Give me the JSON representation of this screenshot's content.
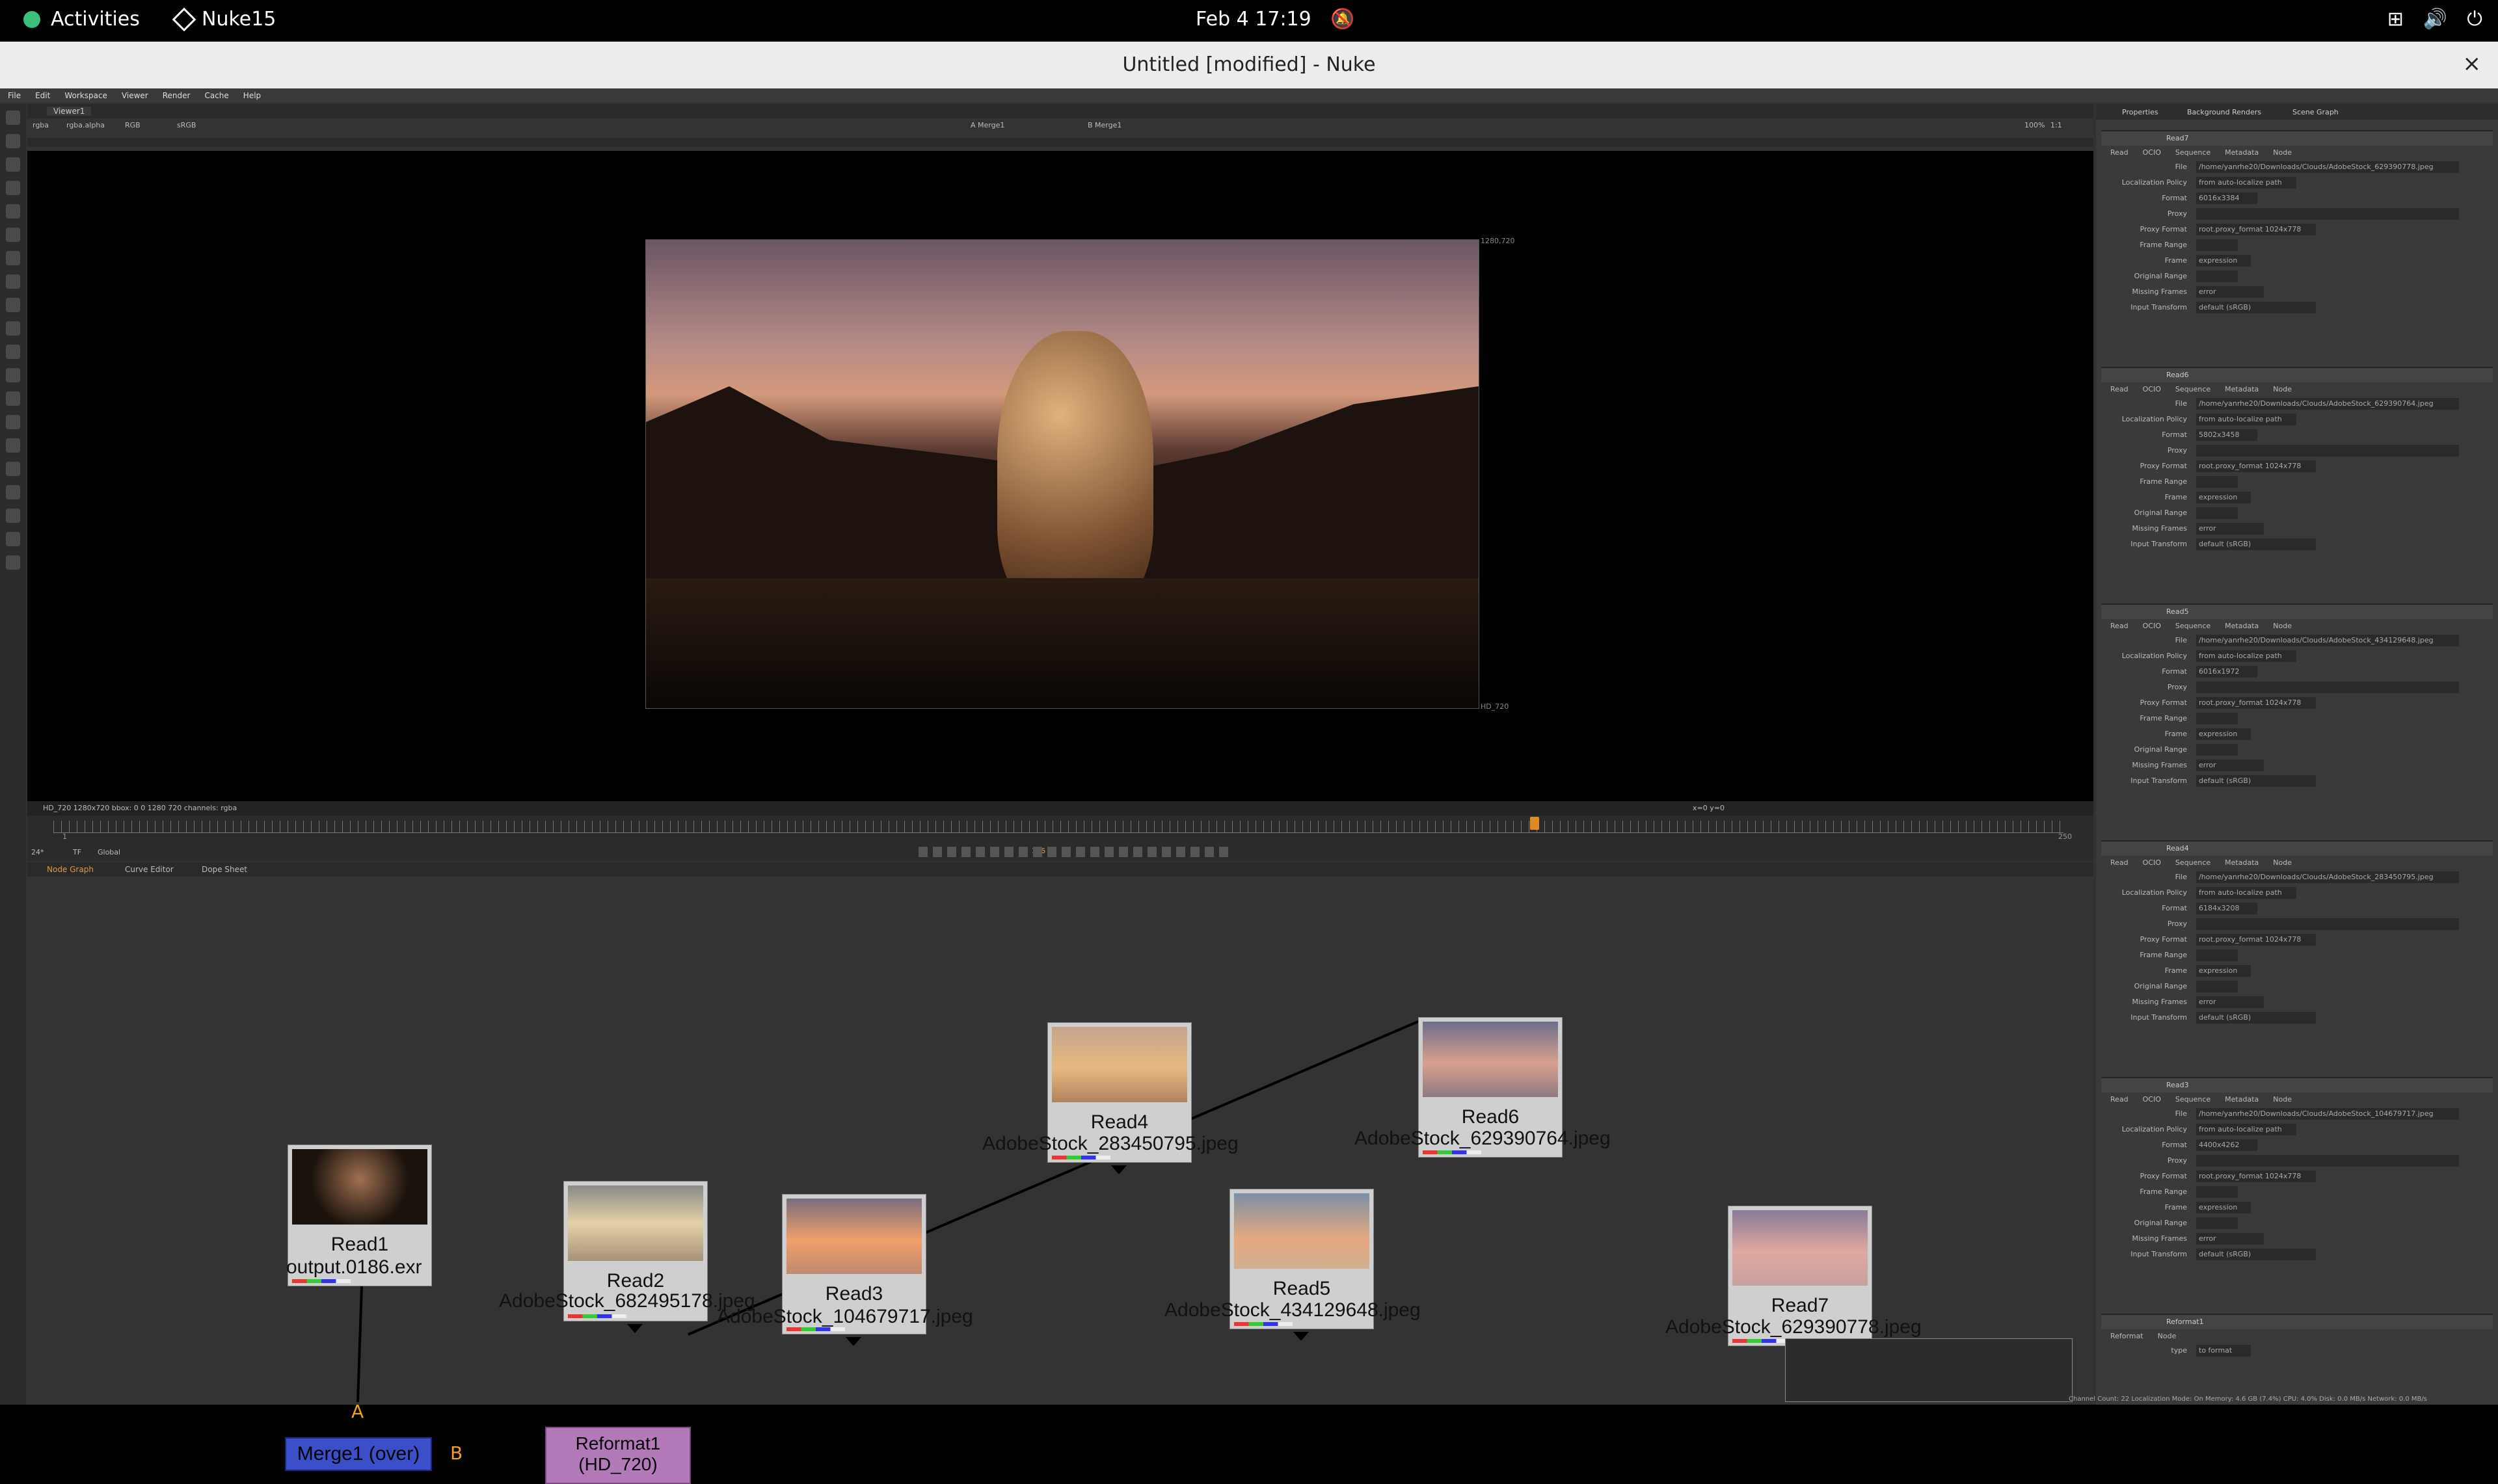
{
  "topbar": {
    "activities": "Activities",
    "app_name": "Nuke15",
    "clock": "Feb 4  17:19"
  },
  "window": {
    "title": "Untitled [modified] - Nuke",
    "close": "×"
  },
  "menubar": [
    "File",
    "Edit",
    "Workspace",
    "Viewer",
    "Render",
    "Cache",
    "Help"
  ],
  "viewer": {
    "tab": "Viewer1",
    "channels": "rgba",
    "alpha": "rgba.alpha",
    "color": "RGB",
    "lut": "sRGB",
    "input_a": "A  Merge1",
    "input_b": "B  Merge1",
    "zoom": "100%",
    "ratio": "1:1",
    "format_top": "1280,720",
    "format_bottom": "HD_720",
    "status": "HD_720 1280x720  bbox: 0 0 1280 720 channels: rgba",
    "coords": "x=0 y=0"
  },
  "timeline": {
    "fps": "24*",
    "tf": "TF",
    "mode": "Global",
    "start": "1",
    "end": "250",
    "current": "186"
  },
  "node_tabs": [
    "Node Graph",
    "Curve Editor",
    "Dope Sheet"
  ],
  "nodes": [
    {
      "name": "Read1",
      "file": "output.0186.exr"
    },
    {
      "name": "Read2",
      "file": "AdobeStock_682495178.jpeg"
    },
    {
      "name": "Read3",
      "file": "AdobeStock_104679717.jpeg"
    },
    {
      "name": "Read4",
      "file": "AdobeStock_283450795.jpeg"
    },
    {
      "name": "Read5",
      "file": "AdobeStock_434129648.jpeg"
    },
    {
      "name": "Read6",
      "file": "AdobeStock_629390764.jpeg"
    },
    {
      "name": "Read7",
      "file": "AdobeStock_629390778.jpeg"
    }
  ],
  "merge": {
    "label": "Merge1 (over)",
    "input_a": "A",
    "input_b": "B"
  },
  "reformat": {
    "label": "Reformat1",
    "sub": "(HD_720)"
  },
  "props": {
    "tabs": [
      "Properties",
      "Background Renders",
      "Scene Graph"
    ],
    "read_tabs": [
      "Read",
      "OCIO",
      "Sequence",
      "Metadata",
      "Node"
    ],
    "labels": {
      "file": "File",
      "localization": "Localization Policy",
      "format": "Format",
      "proxy": "Proxy",
      "proxy_format": "Proxy Format",
      "frame_range": "Frame Range",
      "frame": "Frame",
      "original_range": "Original Range",
      "missing_frames": "Missing Frames",
      "input_transform": "Input Transform"
    },
    "values": {
      "localization": "from auto-localize path",
      "proxy_format": "root.proxy_format 1024x778",
      "frame": "expression",
      "missing": "error",
      "transform": "default (sRGB)"
    },
    "panels": [
      {
        "name": "Read7",
        "file": "/home/yanrhe20/Downloads/Clouds/AdobeStock_629390778.jpeg",
        "format": "6016x3384"
      },
      {
        "name": "Read6",
        "file": "/home/yanrhe20/Downloads/Clouds/AdobeStock_629390764.jpeg",
        "format": "5802x3458"
      },
      {
        "name": "Read5",
        "file": "/home/yanrhe20/Downloads/Clouds/AdobeStock_434129648.jpeg",
        "format": "6016x1972"
      },
      {
        "name": "Read4",
        "file": "/home/yanrhe20/Downloads/Clouds/AdobeStock_283450795.jpeg",
        "format": "6184x3208"
      },
      {
        "name": "Read3",
        "file": "/home/yanrhe20/Downloads/Clouds/AdobeStock_104679717.jpeg",
        "format": "4400x4262"
      }
    ],
    "reformat_panel": {
      "name": "Reformat1",
      "tabs": [
        "Reformat",
        "Node"
      ],
      "type_label": "type",
      "type_value": "to format"
    }
  },
  "bottom_status": "Channel Count: 22  Localization Mode: On  Memory: 4.6 GB (7.4%)  CPU: 4.0%  Disk: 0.0 MB/s  Network: 0.0 MB/s"
}
